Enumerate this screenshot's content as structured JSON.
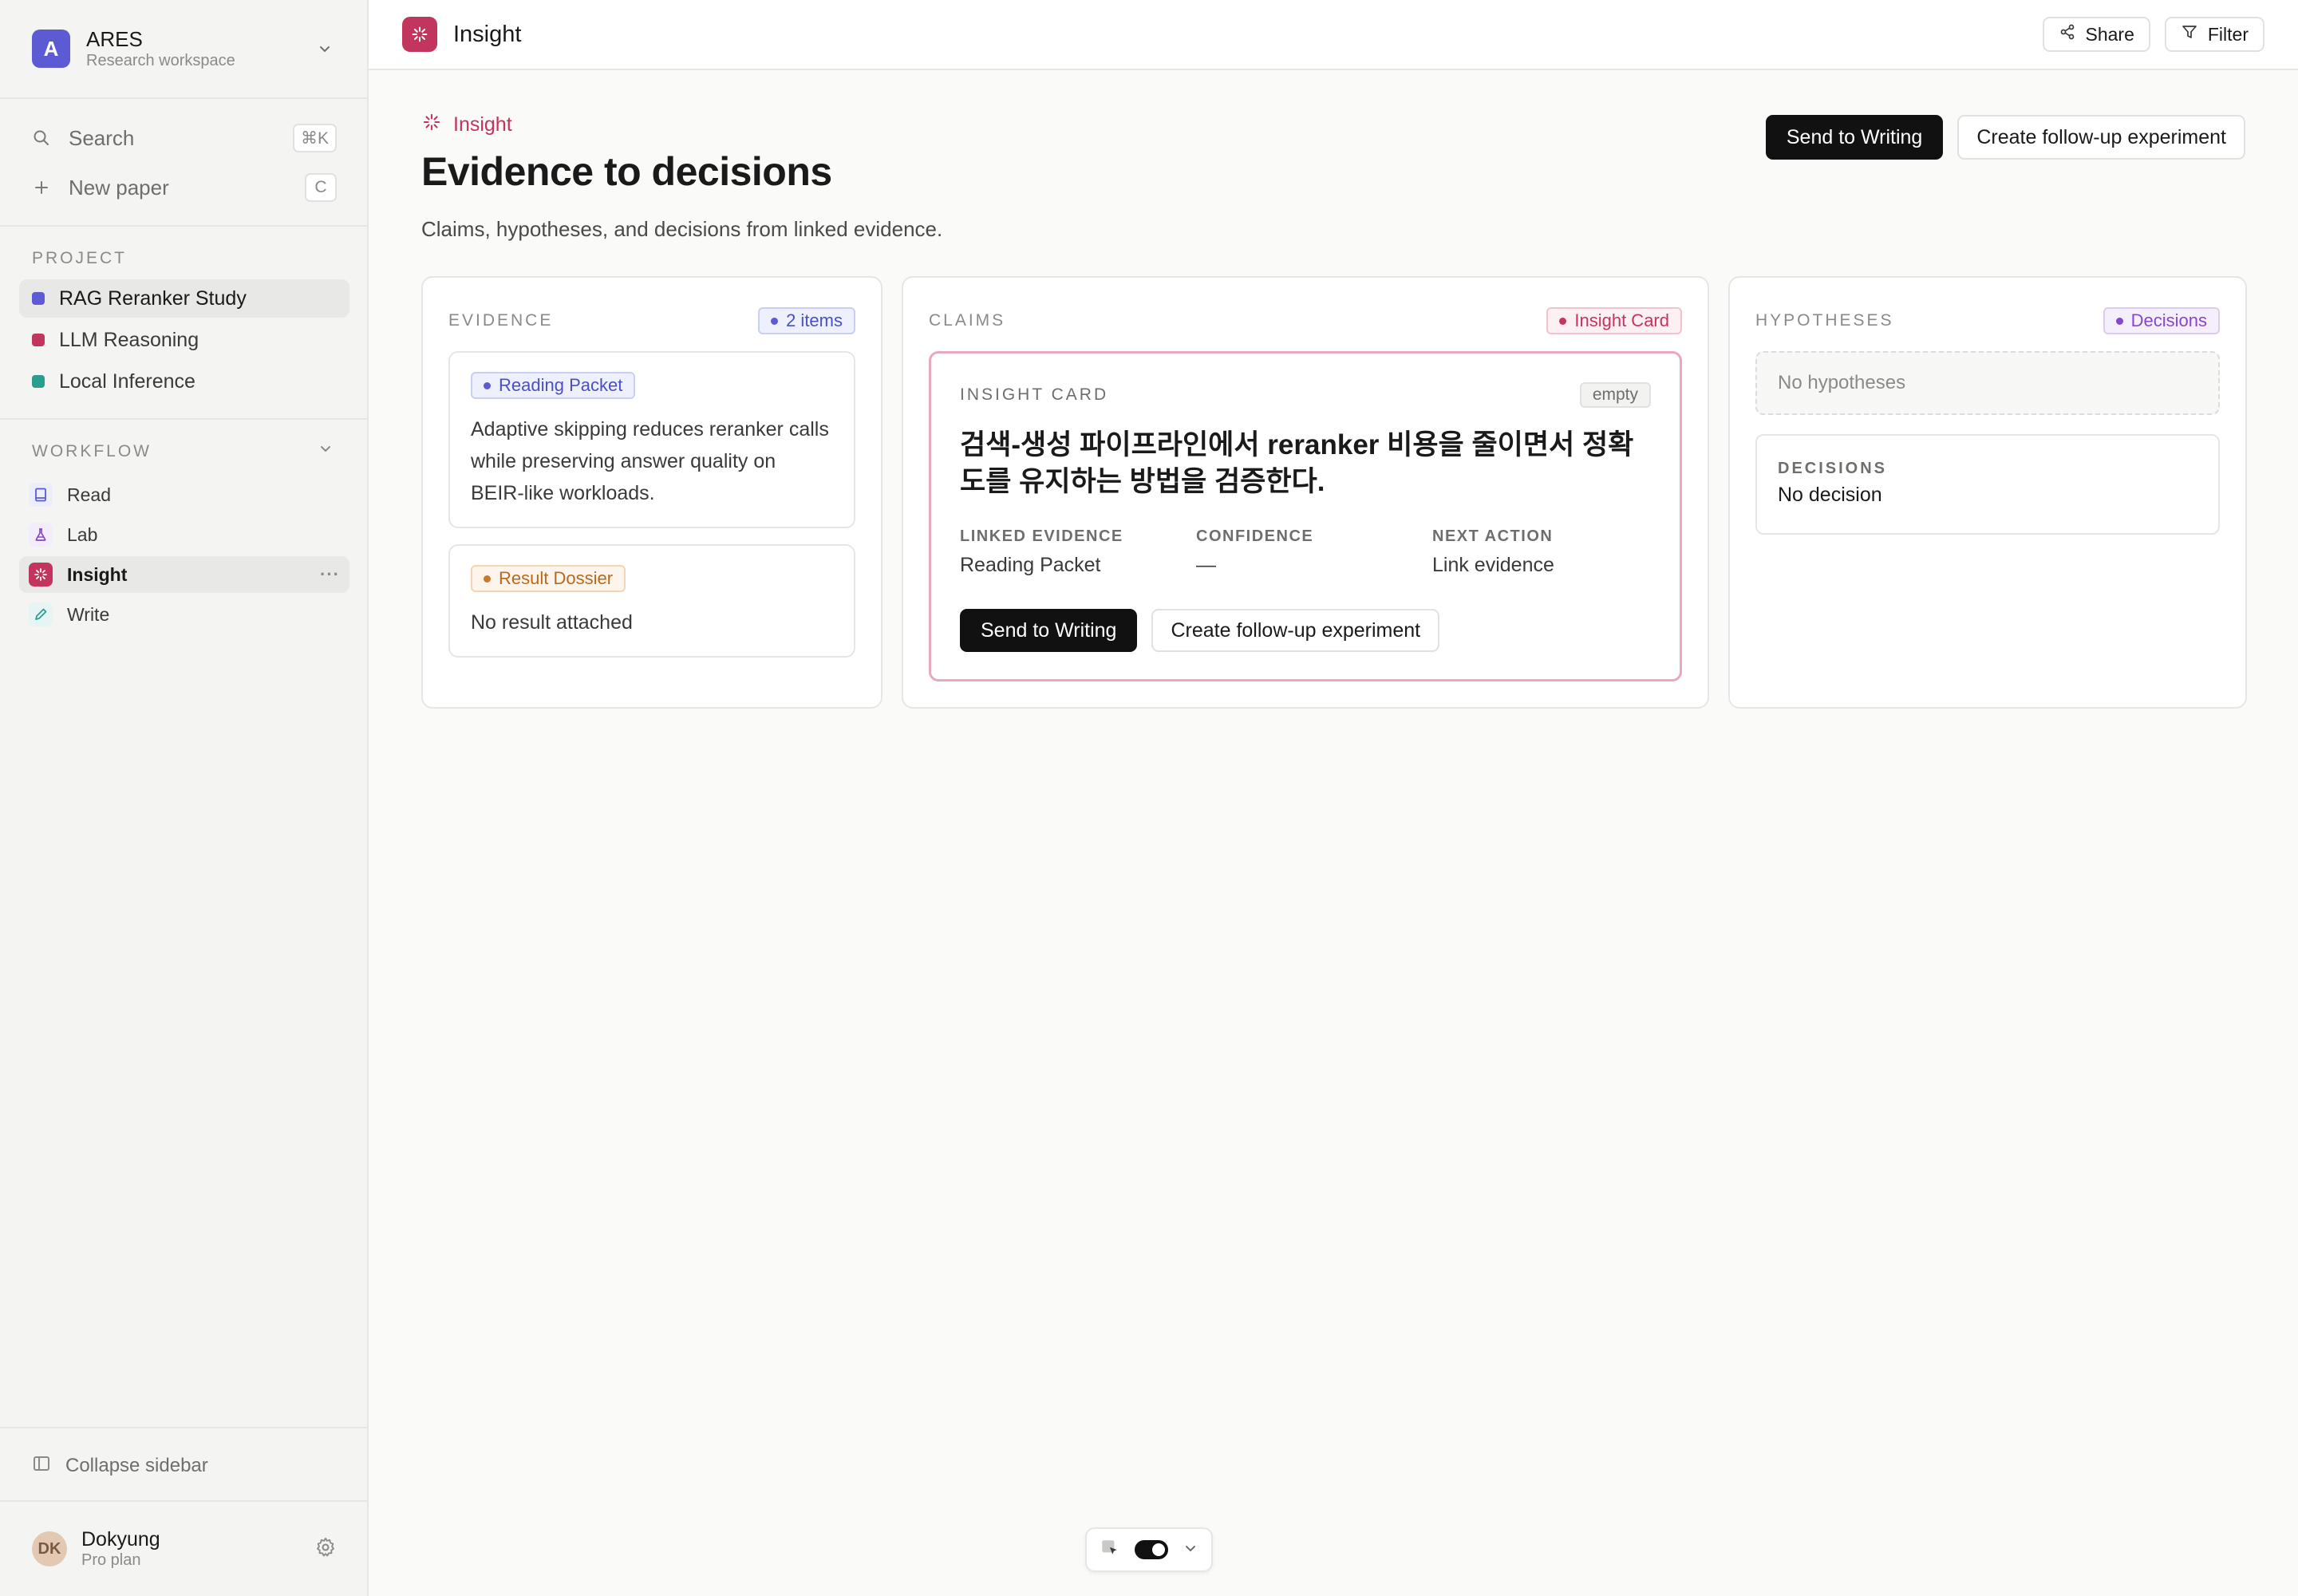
{
  "workspace": {
    "initial": "A",
    "name": "ARES",
    "subtitle": "Research workspace"
  },
  "search": {
    "label": "Search",
    "shortcut": "⌘K"
  },
  "new_paper": {
    "label": "New paper",
    "shortcut": "C"
  },
  "project_section": "PROJECT",
  "projects": [
    {
      "label": "RAG Reranker Study",
      "color": "#5d5bd4",
      "active": true
    },
    {
      "label": "LLM Reasoning",
      "color": "#c2355c",
      "active": false
    },
    {
      "label": "Local Inference",
      "color": "#2a9d8f",
      "active": false
    }
  ],
  "workflow_section": "WORKFLOW",
  "workflow": [
    {
      "label": "Read",
      "icon": "book-icon"
    },
    {
      "label": "Lab",
      "icon": "flask-icon"
    },
    {
      "label": "Insight",
      "icon": "sparkle-icon",
      "active": true
    },
    {
      "label": "Write",
      "icon": "pencil-icon"
    }
  ],
  "collapse_label": "Collapse sidebar",
  "user": {
    "initials": "DK",
    "name": "Dokyung",
    "plan": "Pro plan"
  },
  "topbar": {
    "title": "Insight",
    "share": "Share",
    "filter": "Filter"
  },
  "header": {
    "eyebrow": "Insight",
    "title": "Evidence to decisions",
    "subtitle": "Claims, hypotheses, and decisions from linked evidence.",
    "primary_action": "Send to Writing",
    "secondary_action": "Create follow-up experiment"
  },
  "evidence": {
    "title": "EVIDENCE",
    "badge": "2 items",
    "cards": [
      {
        "tag": "Reading Packet",
        "text": "Adaptive skipping reduces reranker calls while preserving answer quality on BEIR-like workloads."
      },
      {
        "tag": "Result Dossier",
        "text": "No result attached"
      }
    ]
  },
  "claims": {
    "title": "CLAIMS",
    "badge": "Insight Card",
    "card": {
      "label": "INSIGHT CARD",
      "status": "empty",
      "claim": "검색-생성 파이프라인에서 reranker 비용을 줄이면서 정확도를 유지하는 방법을 검증한다.",
      "linked_evidence_label": "LINKED EVIDENCE",
      "linked_evidence_value": "Reading Packet",
      "confidence_label": "CONFIDENCE",
      "confidence_value": "—",
      "next_action_label": "NEXT ACTION",
      "next_action_value": "Link evidence",
      "primary_action": "Send to Writing",
      "secondary_action": "Create follow-up experiment"
    }
  },
  "hypotheses": {
    "title": "HYPOTHESES",
    "badge": "Decisions",
    "empty": "No hypotheses",
    "decisions_label": "DECISIONS",
    "decisions_value": "No decision"
  },
  "colors": {
    "accent": "#c2355c",
    "indigo": "#5d5bd4",
    "teal": "#2a9d8f",
    "purple": "#8647c9",
    "orange": "#c9792a"
  }
}
